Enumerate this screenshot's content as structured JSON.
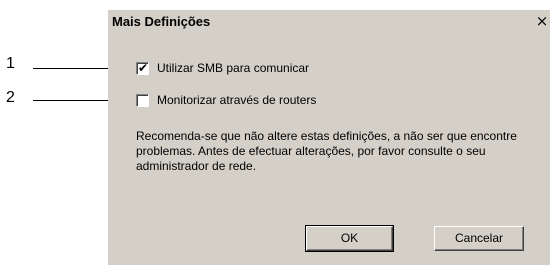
{
  "callouts": [
    {
      "number": "1"
    },
    {
      "number": "2"
    }
  ],
  "dialog": {
    "title": "Mais Definições",
    "close_glyph": "×",
    "options": [
      {
        "label": "Utilizar SMB para comunicar",
        "checked": true
      },
      {
        "label": "Monitorizar através de routers",
        "checked": false
      }
    ],
    "note": "Recomenda-se que não altere estas definições, a não ser que encontre problemas. Antes de efectuar alterações, por favor consulte o seu administrador de rede.",
    "buttons": {
      "ok_label": "OK",
      "cancel_label": "Cancelar"
    }
  },
  "colors": {
    "dialog_face": "#d4d0c8",
    "text": "#000000"
  }
}
